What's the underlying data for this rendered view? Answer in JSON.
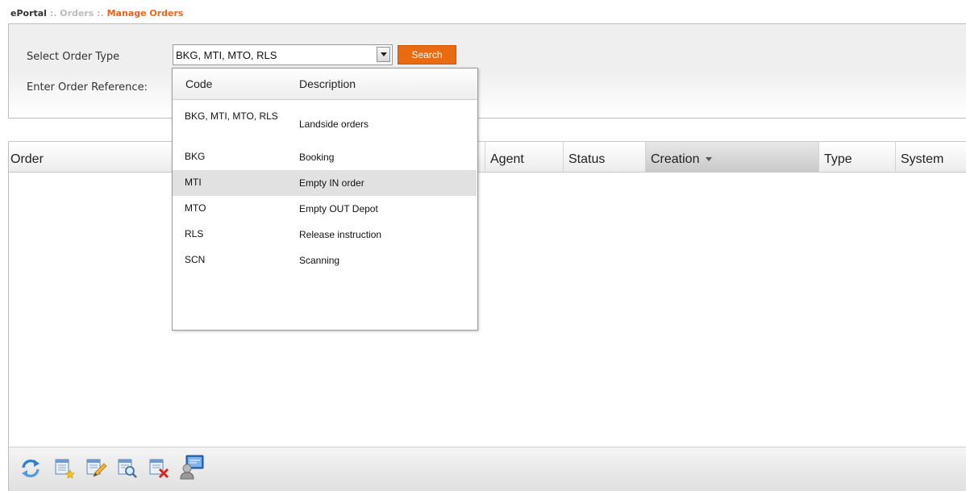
{
  "breadcrumb": {
    "root": "ePortal",
    "sep": ":.",
    "section": "Orders",
    "current": "Manage Orders"
  },
  "filters": {
    "order_type_label": "Select Order Type",
    "order_type_value": "BKG, MTI, MTO, RLS",
    "order_ref_label": "Enter Order Reference:",
    "search_label": "Search"
  },
  "dropdown": {
    "header_code": "Code",
    "header_description": "Description",
    "items": [
      {
        "code": "BKG, MTI, MTO, RLS",
        "description": "Landside orders"
      },
      {
        "code": "BKG",
        "description": "Booking"
      },
      {
        "code": "MTI",
        "description": "Empty IN order"
      },
      {
        "code": "MTO",
        "description": "Empty OUT Depot"
      },
      {
        "code": "RLS",
        "description": "Release instruction"
      },
      {
        "code": "SCN",
        "description": "Scanning"
      }
    ],
    "highlighted_index": 2
  },
  "grid": {
    "columns": [
      "Order",
      "Agent",
      "Status",
      "Creation",
      "Type",
      "System"
    ],
    "sorted_column": "Creation"
  },
  "toolbar": {
    "icons": [
      "refresh-icon",
      "new-order-icon",
      "edit-order-icon",
      "view-order-icon",
      "delete-order-icon",
      "user-screen-icon"
    ]
  },
  "colors": {
    "accent": "#ea6a12",
    "breadcrumb_current": "#e8641b"
  }
}
